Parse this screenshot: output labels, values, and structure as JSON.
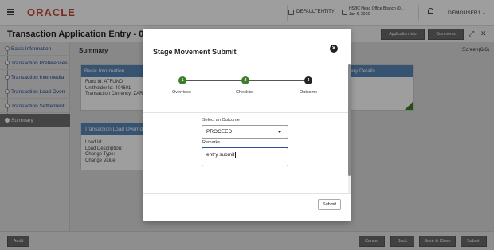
{
  "header": {
    "logo": "ORACLE",
    "entity": "DEFAULTENTITY",
    "branch_line1": "HSBC Head Office Branch (0...",
    "branch_line2": "Jan 6, 2016",
    "user": "DEMOUSER1"
  },
  "page": {
    "title": "Transaction Application Entry - 000AP",
    "btn_application_info": "Application Info",
    "btn_comments": "Comments",
    "summary_heading": "Summary",
    "screen_indicator": "Screen(6/6)"
  },
  "sidebar": {
    "items": [
      {
        "label": "Basic Information"
      },
      {
        "label": "Transaction Preferences"
      },
      {
        "label": "Transaction Intermedia"
      },
      {
        "label": "Transaction Load Overr"
      },
      {
        "label": "Transaction Settlement"
      },
      {
        "label": "Summary"
      }
    ]
  },
  "cards": {
    "basic": {
      "title": "Basic Information",
      "line1": "Fund Id: ATFUND",
      "line2": "Unitholder Id: 404601",
      "line3": "Transaction Currency: ZAR"
    },
    "beneficiary": {
      "title": "iciary Details",
      "line1": "L"
    },
    "load": {
      "title": "Transaction Load Override D",
      "line1": "Load Id:",
      "line2": "Load Description:",
      "line3": "Change Type:",
      "line4": "Change Value:"
    }
  },
  "footer": {
    "audit": "Audit",
    "cancel": "Cancel",
    "back": "Back",
    "save_close": "Save & Close",
    "submit": "Submit"
  },
  "modal": {
    "title": "Stage Movement Submit",
    "steps": [
      {
        "number": "1",
        "label": "Overrides",
        "state": "done"
      },
      {
        "number": "2",
        "label": "Checklist",
        "state": "done"
      },
      {
        "number": "3",
        "label": "Outcome",
        "state": "current"
      }
    ],
    "outcome_label": "Select an Outcome",
    "outcome_value": "PROCEED",
    "remarks_label": "Remarks",
    "remarks_value": "entry submit",
    "submit_label": "Submit"
  },
  "colors": {
    "brand_red": "#c74634",
    "card_header_blue": "#5a87b8",
    "step_done_green": "#3d7d2c",
    "nav_link_blue": "#1f4f9a"
  }
}
